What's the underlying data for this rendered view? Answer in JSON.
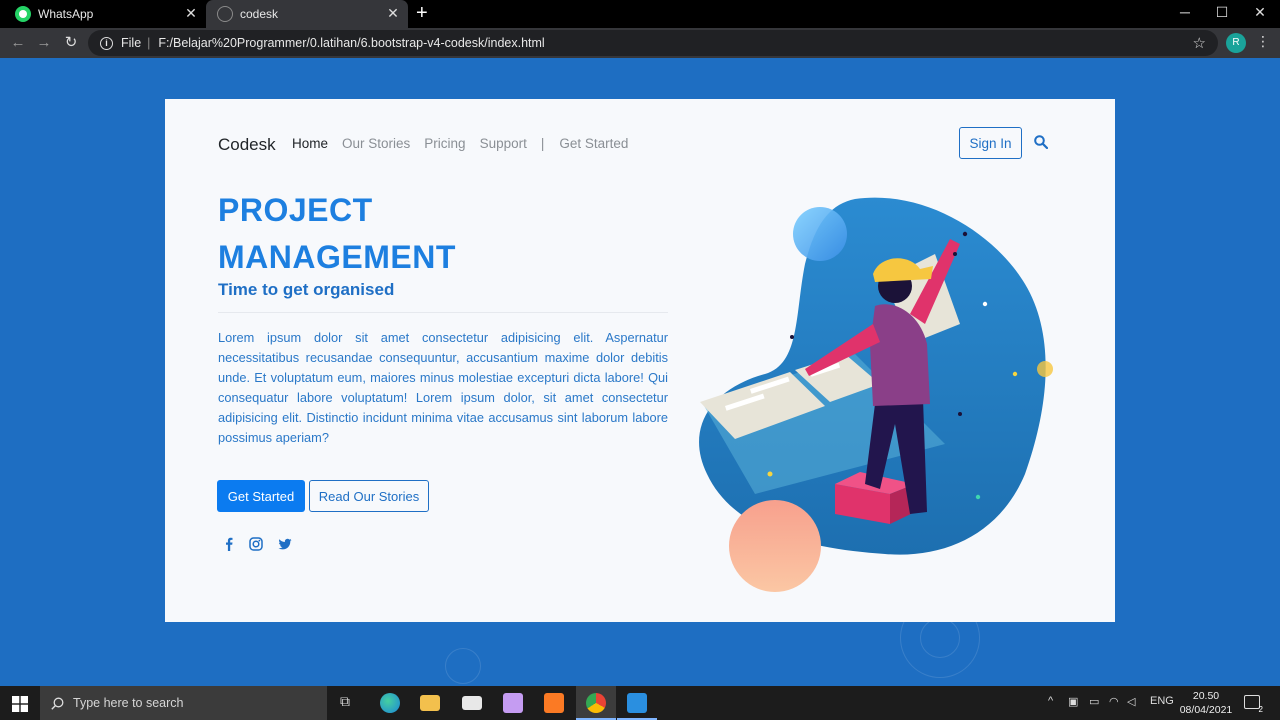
{
  "browser": {
    "tabs": [
      {
        "title": "WhatsApp",
        "icon": "whatsapp-icon"
      },
      {
        "title": "codesk",
        "icon": "globe-icon"
      }
    ],
    "address": {
      "scheme_label": "File",
      "url": "F:/Belajar%20Programmer/0.latihan/6.bootstrap-v4-codesk/index.html"
    },
    "profile_initial": "R"
  },
  "page": {
    "brand": "Codesk",
    "nav": {
      "items": [
        "Home",
        "Our Stories",
        "Pricing",
        "Support"
      ],
      "divider": "|",
      "cta": "Get Started"
    },
    "sign_in": "Sign In",
    "hero": {
      "title_line1": "PROJECT",
      "title_line2": "MANAGEMENT",
      "subtitle": "Time to get organised",
      "body": "Lorem ipsum dolor sit amet consectetur adipisicing elit. Aspernatur necessitatibus recusandae consequuntur, accusantium maxime dolor debitis unde. Et voluptatum eum, maiores minus molestiae excepturi dicta labore! Qui consequatur labore voluptatum! Lorem ipsum dolor, sit amet consectetur adipisicing elit. Distinctio incidunt minima vitae accusamus sint laborum labore possimus aperiam?",
      "primary_button": "Get Started",
      "secondary_button": "Read Our Stories"
    },
    "social": [
      "facebook-icon",
      "instagram-icon",
      "twitter-icon"
    ],
    "colors": {
      "accent": "#0b7bf0",
      "title": "#1d7fe0",
      "background": "#1e6ec2"
    }
  },
  "taskbar": {
    "search_placeholder": "Type here to search",
    "tray": {
      "language": "ENG",
      "time": "20.50",
      "date": "08/04/2021",
      "notification_count": "2"
    }
  }
}
